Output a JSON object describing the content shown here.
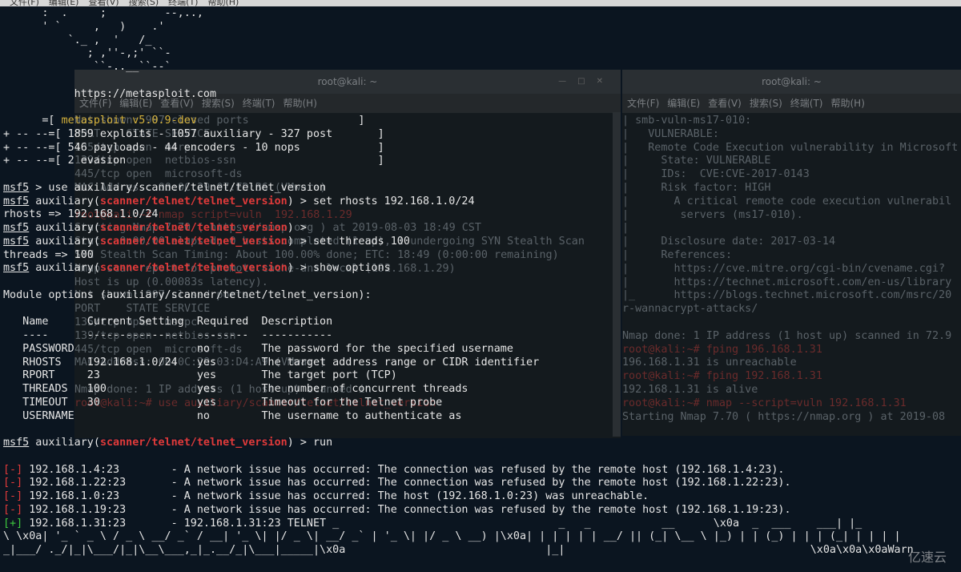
{
  "top_menu": [
    "文件(F)",
    "编辑(E)",
    "查看(V)",
    "搜索(S)",
    "终端(T)",
    "帮助(H)"
  ],
  "bg_term_left": {
    "title": "root@kali: ~",
    "menu": [
      "文件(F)",
      "编辑(E)",
      "查看(V)",
      "搜索(S)",
      "终端(T)",
      "帮助(H)"
    ],
    "lines": [
      "Not shown: 997 closed ports",
      "PORT    STATE SERVICE",
      "135/tcp open  msrpc",
      "139/tcp open  netbios-ssn",
      "445/tcp open  microsoft-ds",
      "MAC Address: 00:0C:29:07:ED:B6 (VMware)",
      "",
      "root@kali:~# nmap script=vuln  192.168.1.29",
      "Starting Nmap 7.70 ( https://nmap.org ) at 2019-08-03 18:49 CST",
      "Stats: 0:00:00 elapsed; 0 hosts completed (1 up), 1 undergoing SYN Stealth Scan",
      "SYN Stealth Scan Timing: About 100.00% done; ETC: 18:49 (0:00:00 remaining)",
      "Nmap scan report for promote.cache-dns.local (192.168.1.29)",
      "Host is up (0.00083s latency).",
      "Not shown: 997 closed ports",
      "PORT    STATE SERVICE",
      "135/tcp open  msrpc",
      "139/tcp open  netbios-ssn",
      "445/tcp open  microsoft-ds",
      "MAC Address: 00:0C:29:03:D4:A9 (VMware)",
      "",
      "Nmap done: 1 IP address (1 host up) scanned in",
      "root@kali:~# use auxiliary/scanner/telnet/telnet_version"
    ]
  },
  "bg_term_right": {
    "title": "root@kali: ~",
    "menu": [
      "文件(F)",
      "编辑(E)",
      "查看(V)",
      "搜索(S)",
      "终端(T)",
      "帮助(H)"
    ],
    "lines": [
      "| smb-vuln-ms17-010:",
      "|   VULNERABLE:",
      "|   Remote Code Execution vulnerability in Microsoft",
      "|     State: VULNERABLE",
      "|     IDs:  CVE:CVE-2017-0143",
      "|     Risk factor: HIGH",
      "|       A critical remote code execution vulnerabil",
      "|        servers (ms17-010).",
      "|",
      "|     Disclosure date: 2017-03-14",
      "|     References:",
      "|       https://cve.mitre.org/cgi-bin/cvename.cgi?",
      "|       https://technet.microsoft.com/en-us/library",
      "|_      https://blogs.technet.microsoft.com/msrc/20",
      "r-wannacrypt-attacks/",
      "",
      "Nmap done: 1 IP address (1 host up) scanned in 72.9",
      "root@kali:~# fping 196.168.1.31",
      "196.168.1.31 is unreachable",
      "root@kali:~# fping 192.168.1.31",
      "192.168.1.31 is alive",
      "root@kali:~# nmap --script=vuln 192.168.1.31",
      "Starting Nmap 7.70 ( https://nmap.org ) at 2019-08"
    ]
  },
  "banner": {
    "art": [
      "      :  .     ;         --,..,",
      "      ' `     ,   )    .'",
      "          `._ ,  '   /_",
      "             ; ,''-,;' ``-",
      "              ``-..__``--`"
    ],
    "url": "           https://metasploit.com",
    "version_prefix": "      =[ ",
    "version": "metasploit v5.0.9-dev",
    "version_suffix": "                         ]",
    "stats": [
      "+ -- --=[ 1859 exploits - 1057 auxiliary - 327 post       ]",
      "+ -- --=[ 546 payloads - 44 encoders - 10 nops            ]",
      "+ -- --=[ 2 evasion                                       ]"
    ]
  },
  "prompt": "msf5",
  "module": "scanner/telnet/telnet_version",
  "session": [
    {
      "type": "plain_prompt",
      "cmd": " > use auxiliary/scanner/telnet/telnet_version"
    },
    {
      "type": "mod_prompt",
      "cmd": " > set rhosts 192.168.1.0/24"
    },
    {
      "type": "out",
      "text": "rhosts => 192.168.1.0/24"
    },
    {
      "type": "mod_prompt",
      "cmd": " > "
    },
    {
      "type": "mod_prompt",
      "cmd": " > set threads 100"
    },
    {
      "type": "out",
      "text": "threads => 100"
    },
    {
      "type": "mod_prompt",
      "cmd": " > show options"
    },
    {
      "type": "out",
      "text": ""
    },
    {
      "type": "out",
      "text": "Module options (auxiliary/scanner/telnet/telnet_version):"
    },
    {
      "type": "out",
      "text": ""
    },
    {
      "type": "out",
      "text": "   Name      Current Setting  Required  Description"
    },
    {
      "type": "out",
      "text": "   ----      ---------------  --------  -----------"
    },
    {
      "type": "out",
      "text": "   PASSWORD                   no        The password for the specified username"
    },
    {
      "type": "out",
      "text": "   RHOSTS    192.168.1.0/24   yes       The target address range or CIDR identifier"
    },
    {
      "type": "out",
      "text": "   RPORT     23               yes       The target port (TCP)"
    },
    {
      "type": "out",
      "text": "   THREADS   100              yes       The number of concurrent threads"
    },
    {
      "type": "out",
      "text": "   TIMEOUT   30               yes       Timeout for the Telnet probe"
    },
    {
      "type": "out",
      "text": "   USERNAME                   no        The username to authenticate as"
    },
    {
      "type": "out",
      "text": ""
    },
    {
      "type": "mod_prompt",
      "cmd": " > run"
    },
    {
      "type": "out",
      "text": ""
    },
    {
      "type": "err",
      "mark": "[-]",
      "text": " 192.168.1.4:23        - A network issue has occurred: The connection was refused by the remote host (192.168.1.4:23)."
    },
    {
      "type": "err",
      "mark": "[-]",
      "text": " 192.168.1.22:23       - A network issue has occurred: The connection was refused by the remote host (192.168.1.22:23)."
    },
    {
      "type": "err",
      "mark": "[-]",
      "text": " 192.168.1.0:23        - A network issue has occurred: The host (192.168.1.0:23) was unreachable."
    },
    {
      "type": "err",
      "mark": "[-]",
      "text": " 192.168.1.19:23       - A network issue has occurred: The connection was refused by the remote host (192.168.1.19:23)."
    },
    {
      "type": "ok",
      "mark": "[+]",
      "text": " 192.168.1.31:23       - 192.168.1.31:23 TELNET _                                  _   _           __      \\x0a  _  ___    ___| |_"
    },
    {
      "type": "out",
      "text": "\\ \\x0a| '_ ` _ \\ / _ \\ __/ _` / __| '_ \\| |/ _ \\| __/ _` | '_ \\| |/ _ \\ __) |\\x0a| | | | | | __/ || (_| \\__ \\ |_) | | (_) | | | (_| | | | |"
    },
    {
      "type": "out",
      "text": "_|___/ ._/|_|\\___/|_|\\__\\___,_|_.__/_|\\___|_____|\\x0a                               |_|                                      \\x0a\\x0a\\x0aWarn"
    }
  ],
  "watermark": "亿速云"
}
